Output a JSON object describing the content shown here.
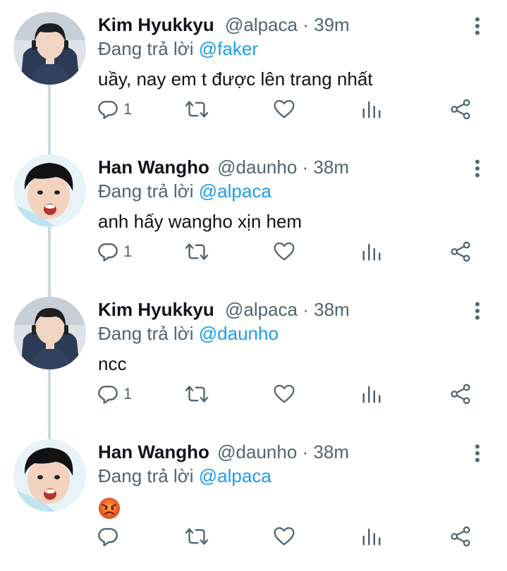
{
  "tweets": [
    {
      "name": "Kim Hyukkyu",
      "handle": "@alpaca",
      "sep": "·",
      "time": "39m",
      "reply_prefix": "Đang trả lời ",
      "reply_to": "@faker",
      "text": "uầy, nay em t được lên trang nhất",
      "reply_count": "1"
    },
    {
      "name": "Han Wangho",
      "handle": "@daunho",
      "sep": "·",
      "time": "38m",
      "reply_prefix": "Đang trả lời ",
      "reply_to": "@alpaca",
      "text": "anh hấy wangho xịn hem",
      "reply_count": "1"
    },
    {
      "name": "Kim Hyukkyu",
      "handle": "@alpaca",
      "sep": "·",
      "time": "38m",
      "reply_prefix": "Đang trả lời ",
      "reply_to": "@daunho",
      "text": "ncc",
      "reply_count": "1"
    },
    {
      "name": "Han Wangho",
      "handle": "@daunho",
      "sep": "·",
      "time": "38m",
      "reply_prefix": "Đang trả lời ",
      "reply_to": "@alpaca",
      "text": "",
      "emoji": "angry-face-emoji",
      "reply_count": ""
    }
  ],
  "icons": {
    "reply": "reply-icon",
    "retweet": "retweet-icon",
    "like": "heart-icon",
    "stats": "stats-icon",
    "share": "share-icon",
    "more": "more-vertical-icon"
  },
  "colors": {
    "icon_gray": "#536471",
    "mention_blue": "#1d9bf0",
    "thread_line": "#cfd9de"
  }
}
